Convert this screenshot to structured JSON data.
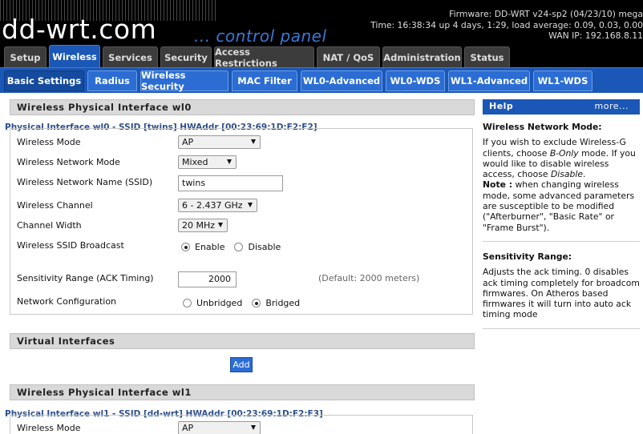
{
  "header": {
    "logo_text": "dd-wrt.com",
    "tagline": "... control panel",
    "firmware": "Firmware: DD-WRT v24-sp2 (04/23/10) mega",
    "time": "Time: 16:38:34 up 4 days, 1:29, load average: 0.09, 0.03, 0.00",
    "wan_ip": "WAN IP: 192.168.8.11"
  },
  "main_tabs": [
    "Setup",
    "Wireless",
    "Services",
    "Security",
    "Access Restrictions",
    "NAT / QoS",
    "Administration",
    "Status"
  ],
  "sub_tabs": [
    "Basic Settings",
    "Radius",
    "Wireless Security",
    "MAC Filter",
    "WL0-Advanced",
    "WL0-WDS",
    "WL1-Advanced",
    "WL1-WDS"
  ],
  "wl0": {
    "section_title": "Wireless Physical Interface wl0",
    "iface_title": "Physical Interface wl0 - SSID [twins] HWAddr [00:23:69:1D:F2:F2]",
    "mode_label": "Wireless Mode",
    "mode_value": "AP",
    "net_mode_label": "Wireless Network Mode",
    "net_mode_value": "Mixed",
    "ssid_label": "Wireless Network Name (SSID)",
    "ssid_value": "twins",
    "channel_label": "Wireless Channel",
    "channel_value": "6 - 2.437 GHz",
    "width_label": "Channel Width",
    "width_value": "20 MHz",
    "broadcast_label": "Wireless SSID Broadcast",
    "broadcast_enable": "Enable",
    "broadcast_disable": "Disable",
    "sensitivity_label": "Sensitivity Range (ACK Timing)",
    "sensitivity_value": "2000",
    "sensitivity_hint": "(Default: 2000 meters)",
    "netconf_label": "Network Configuration",
    "netconf_unbridged": "Unbridged",
    "netconf_bridged": "Bridged"
  },
  "virtual": {
    "section_title": "Virtual Interfaces",
    "add_label": "Add"
  },
  "wl1": {
    "section_title": "Wireless Physical Interface wl1",
    "iface_title": "Physical Interface wl1 - SSID [dd-wrt] HWAddr [00:23:69:1D:F2:F3]",
    "mode_label": "Wireless Mode",
    "mode_value": "AP"
  },
  "help": {
    "title": "Help",
    "more": "more...",
    "mode_heading": "Wireless Network Mode:",
    "mode_text_1": "If you wish to exclude Wireless-G clients, choose ",
    "mode_text_bonly": "B-Only",
    "mode_text_2": " mode. If you would like to disable wireless access, choose ",
    "mode_text_disable": "Disable",
    "mode_text_3": ".",
    "note_label": "Note :",
    "note_text": " when changing wireless mode, some advanced parameters are susceptible to be modified (\"Afterburner\", \"Basic Rate\" or \"Frame Burst\").",
    "sens_heading": "Sensitivity Range:",
    "sens_text": "Adjusts the ack timing. 0 disables ack timing completely for broadcom firmwares. On Atheros based firmwares it will turn into auto ack timing mode"
  }
}
